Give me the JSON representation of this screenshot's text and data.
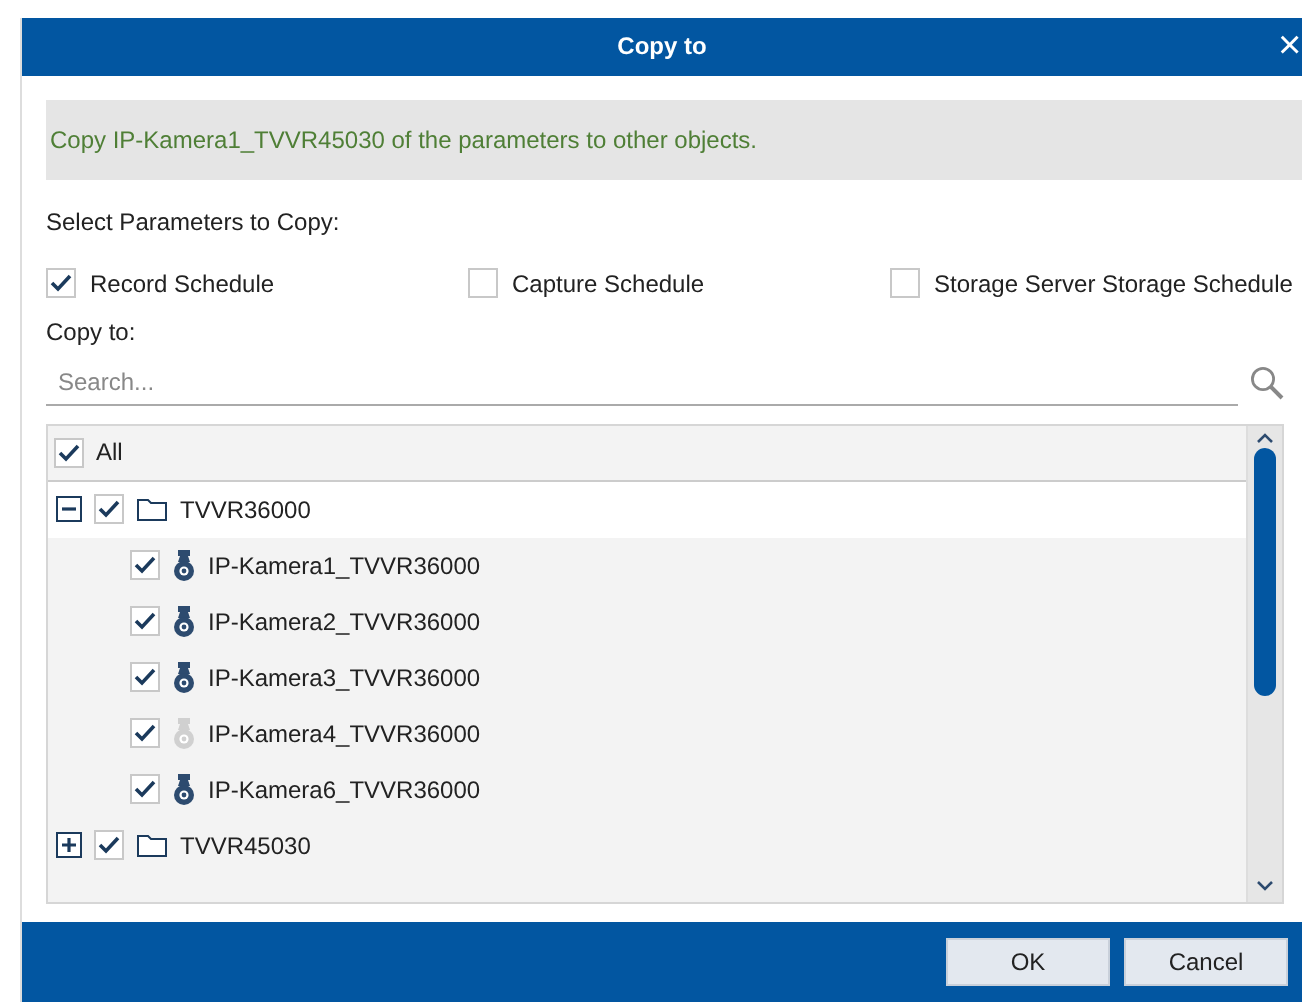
{
  "dialog": {
    "title": "Copy to",
    "close": "×"
  },
  "info": "Copy IP-Kamera1_TVVR45030 of the parameters to other objects.",
  "params_label": "Select Parameters to Copy:",
  "params": [
    {
      "label": "Record Schedule",
      "checked": true
    },
    {
      "label": "Capture Schedule",
      "checked": false
    },
    {
      "label": "Storage Server Storage Schedule",
      "checked": false
    }
  ],
  "copy_to_label": "Copy to:",
  "search": {
    "placeholder": "Search..."
  },
  "tree": {
    "all": {
      "label": "All",
      "checked": true
    },
    "nodes": [
      {
        "label": "TVVR36000",
        "checked": true,
        "expanded": true,
        "children": [
          {
            "label": "IP-Kamera1_TVVR36000",
            "checked": true,
            "online": true
          },
          {
            "label": "IP-Kamera2_TVVR36000",
            "checked": true,
            "online": true
          },
          {
            "label": "IP-Kamera3_TVVR36000",
            "checked": true,
            "online": true
          },
          {
            "label": "IP-Kamera4_TVVR36000",
            "checked": true,
            "online": false
          },
          {
            "label": "IP-Kamera6_TVVR36000",
            "checked": true,
            "online": true
          }
        ]
      },
      {
        "label": "TVVR45030",
        "checked": true,
        "expanded": false
      }
    ]
  },
  "buttons": [
    "OK",
    "Cancel"
  ]
}
